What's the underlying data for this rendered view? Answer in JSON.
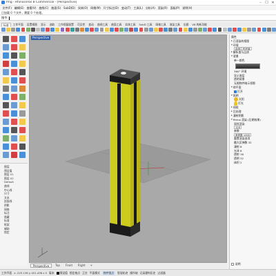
{
  "window": {
    "title": "fmg - Rhinoceros 8 Commercial - [Perspective]",
    "minimize_glyph": "–",
    "maximize_glyph": "☐",
    "close_glyph": "✕"
  },
  "menu": [
    "文件(F)",
    "编辑(E)",
    "查看(V)",
    "曲线(C)",
    "曲面(S)",
    "SubD(D)",
    "实体(O)",
    "网格(M)",
    "尺寸标注(D)",
    "变动(T)",
    "工具(L)",
    "分析(A)",
    "渲染(R)",
    "面板(P)",
    "说明(H)"
  ],
  "command": {
    "history": "已加载 0 个文件，需要 0 个处理。",
    "prompt": "指令:"
  },
  "tabs": [
    "标准",
    "工作平面",
    "设置视图",
    "显示",
    "选取",
    "工作视窗配置",
    "可见性",
    "变动",
    "曲线工具",
    "曲面工具",
    "实体工具",
    "SubD 工具",
    "网格工具",
    "渲染工具",
    "出图",
    "V8 的新功能"
  ],
  "active_tab_index": 0,
  "toolbar_colors": [
    "#6b9bd1",
    "#f2c94c",
    "#9a9a9a",
    "#4a90d9",
    "#e05050",
    "#7fb069",
    "#555555",
    "#c0c0c0",
    "#6b9bd1",
    "#e05050",
    "#4a90d9",
    "#f2c94c",
    "#8e6bbf",
    "#e05050",
    "#3aa0a0",
    "#7a7a7a",
    "#d98a3a",
    "#4a90d9",
    "#e05050",
    "#6b9bd1",
    "#9a9a9a",
    "#f2c94c",
    "#4a90d9",
    "#e05050",
    "#7fb069",
    "#6b9bd1",
    "#c05050",
    "#4a90d9",
    "#e05050",
    "#9a9a9a",
    "#6b9bd1",
    "#f2c94c",
    "#e05050",
    "#4a90d9",
    "#7a7a7a",
    "#6b9bd1",
    "#e05050",
    "#f2c94c",
    "#4a90d9",
    "#9a9a9a",
    "#7fb069",
    "#6b9bd1",
    "#e05050",
    "#4a90d9",
    "#555555",
    "#c0c0c0",
    "#6b9bd1",
    "#e05050",
    "#4a90d9",
    "#f2c94c",
    "#9a9a9a",
    "#6b9bd1",
    "#e05050",
    "#4a90d9",
    "#7a7a7a",
    "#6b9bd1"
  ],
  "left_tool_colors": [
    "#555555",
    "#e05050",
    "#4a90d9",
    "#6b9bd1",
    "#e05050",
    "#f2c94c",
    "#4a90d9",
    "#555555",
    "#7fb069",
    "#d04040",
    "#4a90d9",
    "#f2c94c",
    "#6b9bd1",
    "#e05050",
    "#555555",
    "#f2c94c",
    "#4a90d9",
    "#e05050",
    "#7a7a7a",
    "#6b9bd1",
    "#d98a3a",
    "#4a90d9",
    "#e05050",
    "#7fb069",
    "#555555",
    "#6b9bd1",
    "#f2c94c",
    "#e05050",
    "#4a90d9",
    "#9a9a9a",
    "#6b9bd1",
    "#e05050",
    "#f2c94c",
    "#4a90d9",
    "#555555",
    "#e05050",
    "#7fb069",
    "#6b9bd1",
    "#f2c94c",
    "#4a90d9",
    "#e05050",
    "#555555",
    "#6b9bd1",
    "#d04040",
    "#4a90d9"
  ],
  "layers": [
    "图层",
    "预设值",
    "图层 01",
    "图层 02",
    "Default",
    "曲线",
    "中心线",
    "尺寸",
    "文本",
    "剖面线",
    "阴影",
    "网格",
    "标注",
    "隐藏",
    "标准",
    "框架",
    "辅助",
    "锁定"
  ],
  "viewport": {
    "label": "Perspective",
    "bg_color": "#a8a8a8",
    "object_color": "#d8d020"
  },
  "viewport_tabs": {
    "items": [
      "Perspective",
      "Top",
      "Front",
      "Right"
    ],
    "active": 0,
    "add_glyph": "+"
  },
  "status": {
    "plane": "工作平面",
    "coords": "x -225.136  y 451.436  z 0",
    "unit": "毫米",
    "layer": "预设值",
    "items": [
      "锁定格点",
      "正交",
      "平面模式",
      "物件锁点",
      "智慧轨迹",
      "操作轴",
      "记录建构历史",
      "过滤器"
    ]
  },
  "right_panel": {
    "rows": [
      {
        "text": "属性",
        "level": 0
      },
      {
        "text": "已渲染的视图",
        "level": 0,
        "chev": "▸"
      },
      {
        "text": "环境",
        "level": 0,
        "chev": "▾"
      },
      {
        "text": "自然工作环境",
        "level": 1,
        "field": true
      },
      {
        "text": "解析度与品质",
        "level": 0,
        "chev": "▸"
      },
      {
        "text": "背景",
        "level": 0,
        "chev": "▾"
      },
      {
        "text": "单一颜色",
        "level": 1,
        "swatch": true
      },
      {
        "text": "360° 环境",
        "level": 1
      },
      {
        "text": "显示渐层",
        "level": 1
      },
      {
        "text": "透明背景",
        "level": 1
      },
      {
        "text": "无限物件暗示投影",
        "level": 1
      },
      {
        "text": "地平面",
        "level": 0,
        "chev": "▾"
      },
      {
        "text": "打开",
        "level": 1,
        "check": true
      },
      {
        "text": "照明",
        "level": 0,
        "chev": "▾"
      },
      {
        "text": "太阳",
        "level": 1,
        "sun": true
      },
      {
        "text": "灯光",
        "level": 1,
        "bulb": true
      },
      {
        "text": "线框",
        "level": 0,
        "chev": "▸"
      },
      {
        "text": "后处理",
        "level": 0,
        "chev": "▸"
      },
      {
        "text": "漫射阴影",
        "level": 0,
        "chev": "▸"
      },
      {
        "text": "Rhino 渲染 (后期效果)",
        "level": 0,
        "chev": "▾"
      },
      {
        "text": "采样渲染",
        "level": 1
      },
      {
        "text": "128",
        "level": 1,
        "field": true
      },
      {
        "text": "参数",
        "level": 1
      },
      {
        "text": "采样数 1000",
        "level": 1,
        "field": true
      },
      {
        "text": "重置渲染选项",
        "level": 1
      },
      {
        "text": "最大反弹数 32",
        "level": 1
      },
      {
        "text": "漫射 8",
        "level": 1
      },
      {
        "text": "光泽 8",
        "level": 1
      },
      {
        "text": "透射 16",
        "level": 1
      },
      {
        "text": "透明 32",
        "level": 1
      },
      {
        "text": "体积 2",
        "level": 1
      }
    ],
    "help": "说明"
  }
}
